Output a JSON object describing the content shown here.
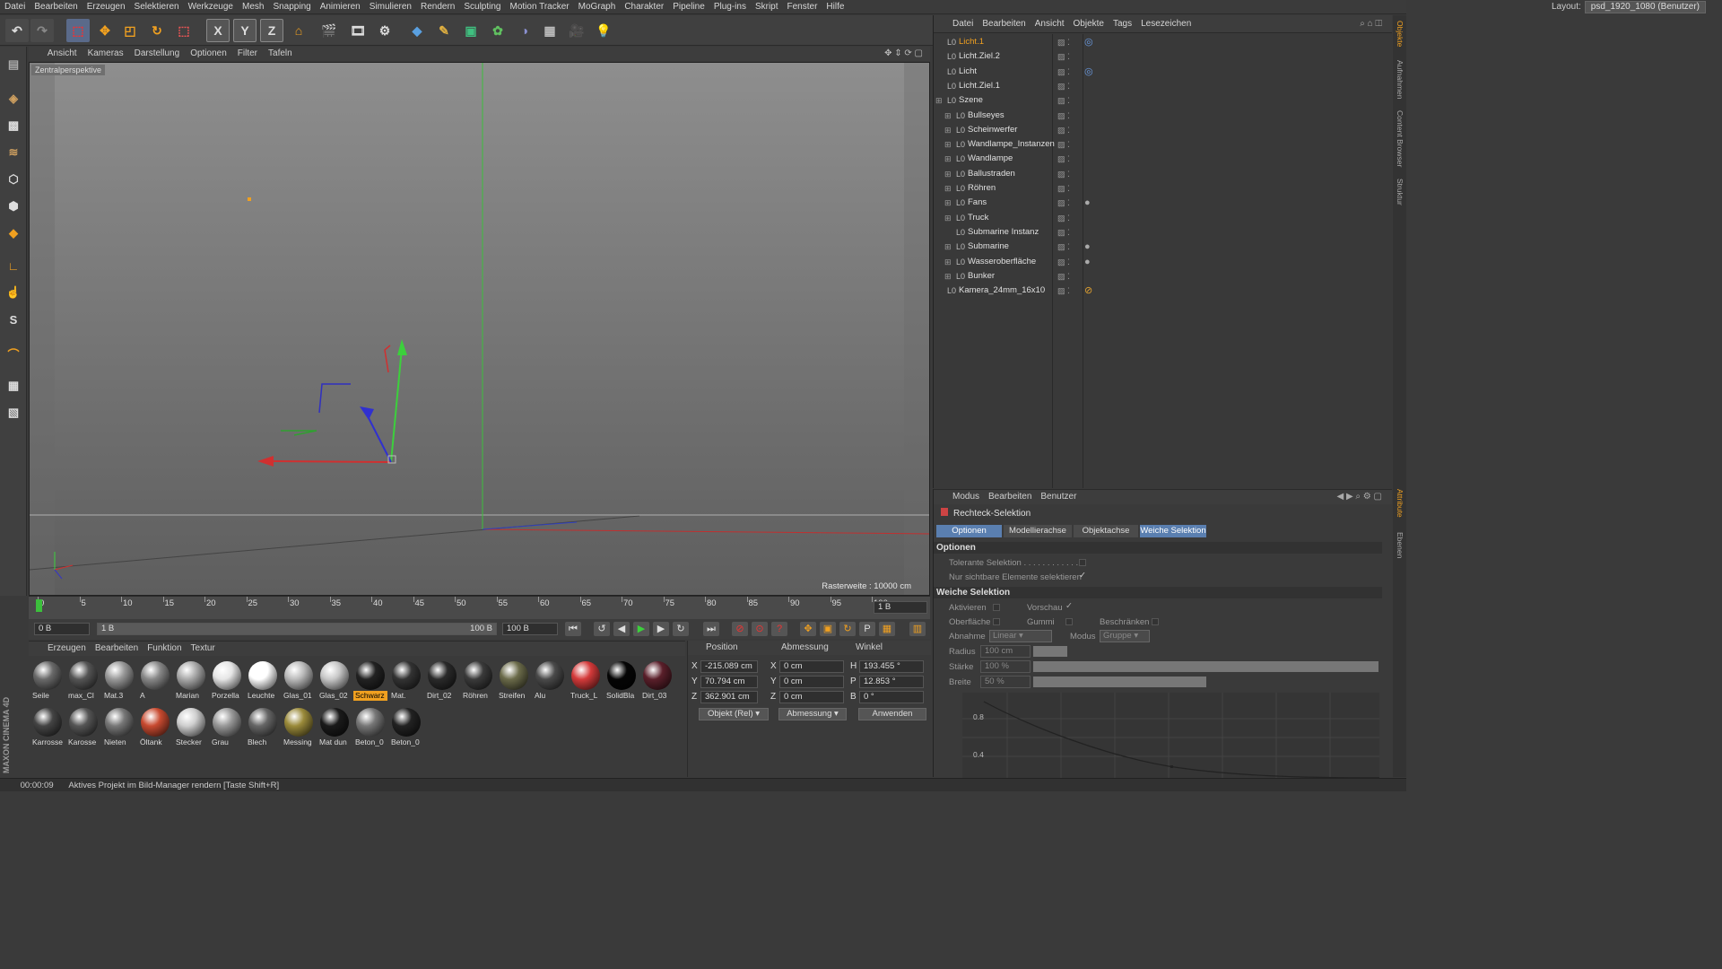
{
  "menu": [
    "Datei",
    "Bearbeiten",
    "Erzeugen",
    "Selektieren",
    "Werkzeuge",
    "Mesh",
    "Snapping",
    "Animieren",
    "Simulieren",
    "Rendern",
    "Sculpting",
    "Motion Tracker",
    "MoGraph",
    "Charakter",
    "Pipeline",
    "Plug-ins",
    "Skript",
    "Fenster",
    "Hilfe"
  ],
  "layout": {
    "label": "Layout:",
    "value": "psd_1920_1080 (Benutzer)"
  },
  "viewport": {
    "menu": [
      "Ansicht",
      "Kameras",
      "Darstellung",
      "Optionen",
      "Filter",
      "Tafeln"
    ],
    "label": "Zentralperspektive",
    "raster": "Rasterweite : 10000 cm"
  },
  "timeline": {
    "ticks": [
      "0",
      "5",
      "10",
      "15",
      "20",
      "25",
      "30",
      "35",
      "40",
      "45",
      "50",
      "55",
      "60",
      "65",
      "70",
      "75",
      "80",
      "85",
      "90",
      "95",
      "100"
    ],
    "current": "1 B",
    "start": "0 B",
    "range_start": "1 B",
    "range_end": "100 B",
    "end": "100 B"
  },
  "materials": {
    "menu": [
      "Erzeugen",
      "Bearbeiten",
      "Funktion",
      "Textur"
    ],
    "row1": [
      {
        "n": "Seile",
        "c": "#6a6a6a"
      },
      {
        "n": "max_Cl",
        "c": "#555"
      },
      {
        "n": "Mat.3",
        "c": "#999"
      },
      {
        "n": "A",
        "c": "#888"
      },
      {
        "n": "Marian",
        "c": "#aaa"
      },
      {
        "n": "Porzella",
        "c": "#e6e6e6"
      },
      {
        "n": "Leuchte",
        "c": "#ffffff"
      },
      {
        "n": "Glas_01",
        "c": "#bbb"
      },
      {
        "n": "Glas_02",
        "c": "#c8c8c8"
      },
      {
        "n": "Schwarz",
        "c": "#222"
      },
      {
        "n": "Mat.",
        "c": "#333"
      },
      {
        "n": "Dirt_02",
        "c": "#2a2a2a"
      },
      {
        "n": "Röhren",
        "c": "#3a3a3a"
      },
      {
        "n": "Streifen",
        "c": "#6b6b4a"
      },
      {
        "n": "Alu",
        "c": "#4a4a4a"
      },
      {
        "n": "Truck_L",
        "c": "#d43a3a"
      },
      {
        "n": "SolidBla",
        "c": "#050505"
      },
      {
        "n": "Dirt_03",
        "c": "#5a1f2a"
      }
    ],
    "row2": [
      {
        "n": "Karrosse",
        "c": "#444"
      },
      {
        "n": "Karosse",
        "c": "#555"
      },
      {
        "n": "Nieten",
        "c": "#777"
      },
      {
        "n": "Öltank",
        "c": "#c84a30"
      },
      {
        "n": "Stecker",
        "c": "#cfcfcf"
      },
      {
        "n": "Grau",
        "c": "#999"
      },
      {
        "n": "Blech",
        "c": "#666"
      },
      {
        "n": "Messing",
        "c": "#9a8a3a"
      },
      {
        "n": "Mat dun",
        "c": "#1a1a1a"
      },
      {
        "n": "Beton_0",
        "c": "#777"
      },
      {
        "n": "Beton_0",
        "c": "#222"
      }
    ]
  },
  "coords": {
    "headers": [
      "Position",
      "Abmessung",
      "Winkel"
    ],
    "rows": [
      {
        "a": "X",
        "pos": "-215.089 cm",
        "b": "X",
        "size": "0 cm",
        "c": "H",
        "ang": "193.455 °"
      },
      {
        "a": "Y",
        "pos": "70.794 cm",
        "b": "Y",
        "size": "0 cm",
        "c": "P",
        "ang": "12.853 °"
      },
      {
        "a": "Z",
        "pos": "362.901 cm",
        "b": "Z",
        "size": "0 cm",
        "c": "B",
        "ang": "0 °"
      }
    ],
    "mode": "Objekt (Rel)",
    "sizemode": "Abmessung",
    "apply": "Anwenden"
  },
  "objects": {
    "menu": [
      "Datei",
      "Bearbeiten",
      "Ansicht",
      "Objekte",
      "Tags",
      "Lesezeichen"
    ],
    "rows": [
      {
        "n": "Licht.1",
        "ind": 0,
        "sel": true,
        "tag": "target"
      },
      {
        "n": "Licht.Ziel.2",
        "ind": 0
      },
      {
        "n": "Licht",
        "ind": 0,
        "tag": "target"
      },
      {
        "n": "Licht.Ziel.1",
        "ind": 0
      },
      {
        "n": "Szene",
        "ind": 0
      },
      {
        "n": "Bullseyes",
        "ind": 1
      },
      {
        "n": "Scheinwerfer",
        "ind": 1
      },
      {
        "n": "Wandlampe_Instanzen",
        "ind": 1
      },
      {
        "n": "Wandlampe",
        "ind": 1
      },
      {
        "n": "Ballustraden",
        "ind": 1
      },
      {
        "n": "Röhren",
        "ind": 1
      },
      {
        "n": "Fans",
        "ind": 1,
        "tag": "mat"
      },
      {
        "n": "Truck",
        "ind": 1
      },
      {
        "n": "Submarine Instanz",
        "ind": 1
      },
      {
        "n": "Submarine",
        "ind": 1,
        "tag": "mat"
      },
      {
        "n": "Wasseroberfläche",
        "ind": 1,
        "tag": "mat"
      },
      {
        "n": "Bunker",
        "ind": 1
      },
      {
        "n": "Kamera_24mm_16x10",
        "ind": 0,
        "tag": "cam"
      }
    ]
  },
  "attributes": {
    "menu": [
      "Modus",
      "Bearbeiten",
      "Benutzer"
    ],
    "title": "Rechteck-Selektion",
    "tabs": [
      "Optionen",
      "Modellierachse",
      "Objektachse",
      "Weiche Selektion"
    ],
    "section1": "Optionen",
    "tol": "Tolerante Selektion . . . . . . . . . . . .",
    "visible": "Nur sichtbare Elemente selektieren",
    "section2": "Weiche Selektion",
    "aktivieren": "Aktivieren",
    "vorschau": "Vorschau",
    "oberflaeche": "Oberfläche",
    "gummi": "Gummi",
    "beschr": "Beschränken",
    "abnahme": "Abnahme",
    "abnahme_val": "Linear",
    "modus": "Modus",
    "modus_val": "Gruppe",
    "radius": "Radius",
    "radius_val": "100 cm",
    "staerke": "Stärke",
    "staerke_val": "100 %",
    "staerke_frac": 1.0,
    "breite": "Breite",
    "breite_val": "50 %",
    "breite_frac": 0.5,
    "graph_y": [
      "0.8",
      "0.4"
    ]
  },
  "rightstrip": [
    "Objekte",
    "Aufnahmen",
    "Content Browser",
    "Struktur",
    "Attribute",
    "Ebenen"
  ],
  "status": {
    "time": "00:00:09",
    "msg": "Aktives Projekt im Bild-Manager rendern [Taste Shift+R]"
  },
  "brand": "MAXON CINEMA 4D"
}
